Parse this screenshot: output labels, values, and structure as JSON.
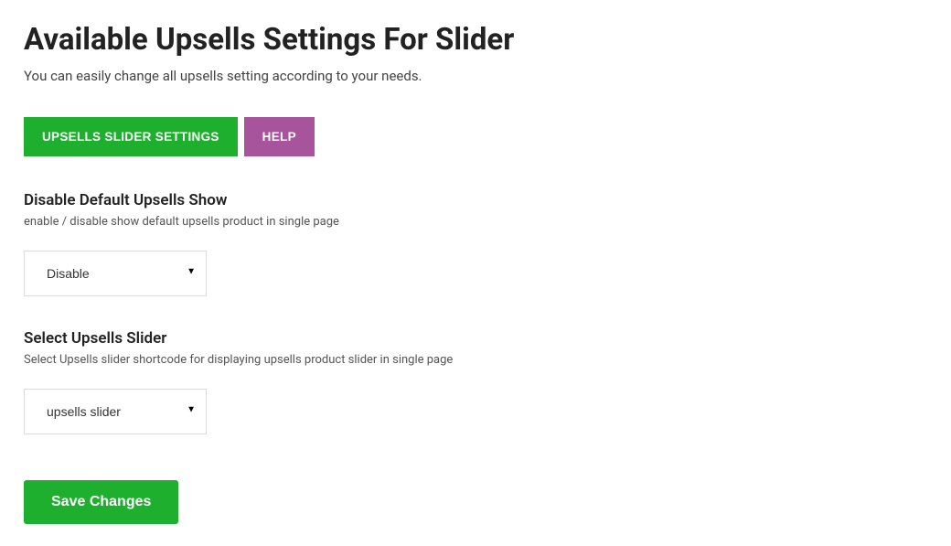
{
  "header": {
    "title": "Available Upsells Settings For Slider",
    "subtitle": "You can easily change all upsells setting according to your needs."
  },
  "toolbar": {
    "settings_label": "UPSELLS SLIDER SETTINGS",
    "help_label": "HELP"
  },
  "sections": {
    "disable_default": {
      "title": "Disable Default Upsells Show",
      "description": "enable / disable show default upsells product in single page",
      "selected": "Disable"
    },
    "select_slider": {
      "title": "Select Upsells Slider",
      "description": "Select Upsells slider shortcode for displaying upsells product slider in single page",
      "selected": "upsells slider"
    }
  },
  "actions": {
    "save_label": "Save Changes"
  }
}
